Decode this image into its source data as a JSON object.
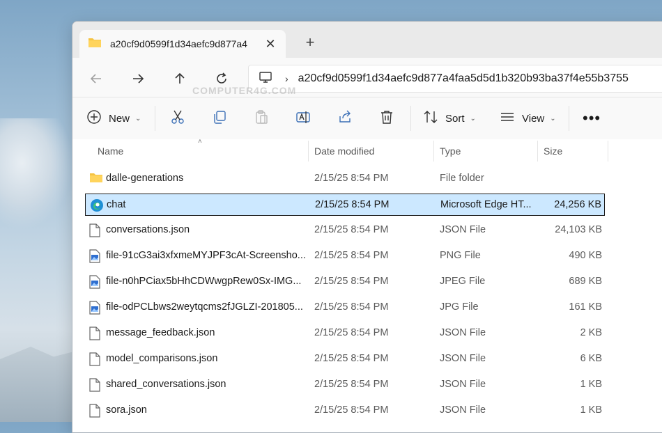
{
  "tab": {
    "title": "a20cf9d0599f1d34aefc9d877a4"
  },
  "address": {
    "path": "a20cf9d0599f1d34aefc9d877a4faa5d5d1b320b93ba37f4e55b3755"
  },
  "watermark": "COMPUTER4G.COM",
  "toolbar": {
    "new_label": "New",
    "sort_label": "Sort",
    "view_label": "View"
  },
  "columns": {
    "name": "Name",
    "date": "Date modified",
    "type": "Type",
    "size": "Size"
  },
  "icons": {
    "folder": "folder-icon",
    "edge": "edge-icon",
    "file": "file-icon",
    "image": "image-file-icon"
  },
  "colors": {
    "selection": "#cce8ff",
    "folder": "#f5c342"
  },
  "files": [
    {
      "name": "dalle-generations",
      "date": "2/15/25 8:54 PM",
      "type": "File folder",
      "size": "",
      "icon": "folder"
    },
    {
      "name": "chat",
      "date": "2/15/25 8:54 PM",
      "type": "Microsoft Edge HT...",
      "size": "24,256 KB",
      "icon": "edge",
      "selected": true
    },
    {
      "name": "conversations.json",
      "date": "2/15/25 8:54 PM",
      "type": "JSON File",
      "size": "24,103 KB",
      "icon": "file"
    },
    {
      "name": "file-91cG3ai3xfxmeMYJPF3cAt-Screensho...",
      "date": "2/15/25 8:54 PM",
      "type": "PNG File",
      "size": "490 KB",
      "icon": "image"
    },
    {
      "name": "file-n0hPCiax5bHhCDWwgpRew0Sx-IMG...",
      "date": "2/15/25 8:54 PM",
      "type": "JPEG File",
      "size": "689 KB",
      "icon": "image"
    },
    {
      "name": "file-odPCLbws2weytqcms2fJGLZI-201805...",
      "date": "2/15/25 8:54 PM",
      "type": "JPG File",
      "size": "161 KB",
      "icon": "image"
    },
    {
      "name": "message_feedback.json",
      "date": "2/15/25 8:54 PM",
      "type": "JSON File",
      "size": "2 KB",
      "icon": "file"
    },
    {
      "name": "model_comparisons.json",
      "date": "2/15/25 8:54 PM",
      "type": "JSON File",
      "size": "6 KB",
      "icon": "file"
    },
    {
      "name": "shared_conversations.json",
      "date": "2/15/25 8:54 PM",
      "type": "JSON File",
      "size": "1 KB",
      "icon": "file"
    },
    {
      "name": "sora.json",
      "date": "2/15/25 8:54 PM",
      "type": "JSON File",
      "size": "1 KB",
      "icon": "file"
    }
  ]
}
